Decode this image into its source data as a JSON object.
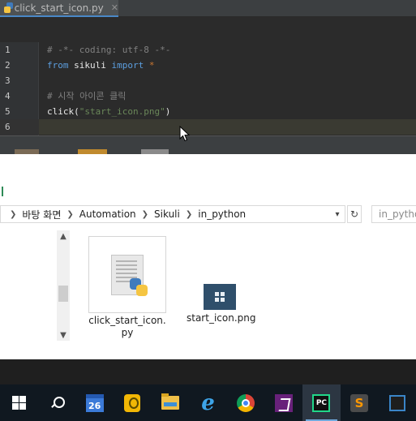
{
  "editor": {
    "tab": {
      "label": "click_start_icon.py",
      "close": "✕"
    },
    "lines": [
      {
        "num": "1",
        "html": "<span class='cm'># -*- coding: utf-8 -*-</span>"
      },
      {
        "num": "2",
        "html": "<span class='kw2'>from</span> <span class='plain'>sikuli</span> <span class='kw2'>import</span> <span class='kw'>*</span>"
      },
      {
        "num": "3",
        "html": ""
      },
      {
        "num": "4",
        "html": "<span class='cm'># 시작 아이콘 클릭</span>"
      },
      {
        "num": "5",
        "html": "<span class='plain'>click(</span><span class='str'>\"start_icon.png\"</span><span class='plain'>)</span>"
      },
      {
        "num": "6",
        "html": ""
      }
    ],
    "current_line": 6
  },
  "explorer": {
    "breadcrumb": [
      "바탕 화면",
      "Automation",
      "Sikuli",
      "in_python"
    ],
    "search_placeholder": "in_pytho",
    "files": [
      {
        "name": "click_start_icon.py",
        "type": "python-file-icon"
      },
      {
        "name": "start_icon.png",
        "type": "image-file-icon"
      }
    ],
    "selected_file": "click_start_icon.py"
  },
  "taskbar": {
    "calendar_day": "26",
    "pycharm_label": "PC",
    "apps": [
      "start-button",
      "search",
      "calendar",
      "keep",
      "file-explorer",
      "internet-explorer",
      "chrome",
      "visual-studio",
      "pycharm",
      "sublime-text",
      "other"
    ],
    "active_app": "pycharm"
  },
  "colors": {
    "editor_bg": "#2b2b2b",
    "taskbar_bg": "#101820",
    "accent": "#4a88c7",
    "pycharm_green": "#21d789"
  }
}
